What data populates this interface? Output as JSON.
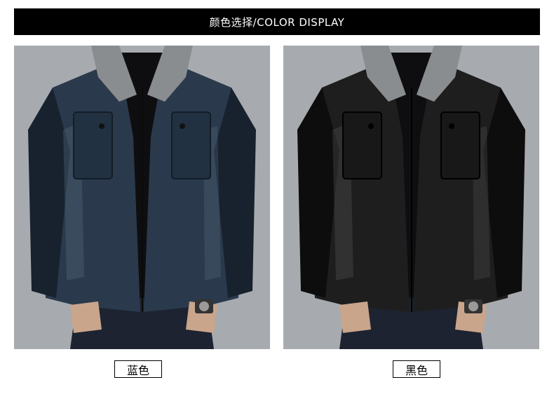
{
  "header": {
    "title": "颜色选择/COLOR DISPLAY"
  },
  "variants": [
    {
      "label": "蓝色",
      "jacket_color": "#2a3a4c",
      "jacket_shade": "#18222e",
      "jacket_highlight": "#5a6c80"
    },
    {
      "label": "黑色",
      "jacket_color": "#1e1e1e",
      "jacket_shade": "#0d0d0d",
      "jacket_highlight": "#4e4e4e"
    }
  ],
  "colors": {
    "background": "#9fa3a8",
    "collar": "#8a8d90",
    "sweater": "#0e0e10",
    "jeans": "#1d2330"
  }
}
